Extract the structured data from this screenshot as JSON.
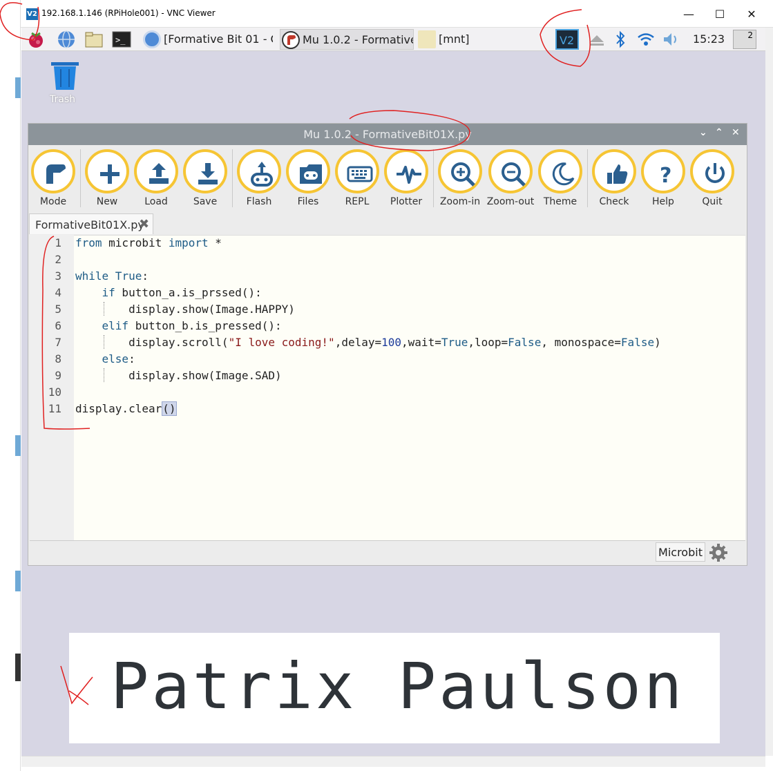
{
  "vnc": {
    "title": "192.168.1.146 (RPiHole001) - VNC Viewer",
    "logo": "V2",
    "minimize": "—",
    "maximize": "☐",
    "close": "✕"
  },
  "panel": {
    "tasks": [
      {
        "label": "[Formative Bit 01 - C..."
      },
      {
        "label": "Mu 1.0.2 - Formative..."
      },
      {
        "label": "[mnt]"
      }
    ],
    "clock": "15:23",
    "workspace": "2"
  },
  "desktop": {
    "trash_label": "Trash"
  },
  "mu": {
    "title": "Mu 1.0.2 - FormativeBit01X.py",
    "buttons": [
      "Mode",
      "New",
      "Load",
      "Save",
      "Flash",
      "Files",
      "REPL",
      "Plotter",
      "Zoom-in",
      "Zoom-out",
      "Theme",
      "Check",
      "Help",
      "Quit"
    ],
    "tab_name": "FormativeBit01X.py",
    "tab_close": "✖",
    "line_numbers": [
      "1",
      "2",
      "3",
      "4",
      "5",
      "6",
      "7",
      "8",
      "9",
      "10",
      "11"
    ],
    "code": {
      "l1_from": "from",
      "l1_mid": " microbit ",
      "l1_import": "import",
      "l1_end": " *",
      "l3_while": "while",
      "l3_true": " True",
      "l3_end": ":",
      "l4_if": "    if",
      "l4_rest": " button_a.is_prssed():",
      "l5": "        display.show(Image.HAPPY)",
      "l6_elif": "    elif",
      "l6_rest": " button_b.is_pressed():",
      "l7_a": "        display.scroll(",
      "l7_str": "\"I love coding!\"",
      "l7_b": ",delay=",
      "l7_num": "100",
      "l7_c": ",wait=",
      "l7_true": "True",
      "l7_d": ",loop=",
      "l7_false1": "False",
      "l7_e": ", monospace=",
      "l7_false2": "False",
      "l7_f": ")",
      "l8_else": "    else",
      "l8_end": ":",
      "l9": "        display.show(Image.SAD)",
      "l11_a": "display.clear",
      "l11_b": "()"
    },
    "mode": "Microbit"
  },
  "signature": "Patrix Paulson",
  "colors": {
    "button_ring": "#f6c534",
    "icon_blue": "#2b5f8f",
    "annotation_red": "#e02020"
  }
}
